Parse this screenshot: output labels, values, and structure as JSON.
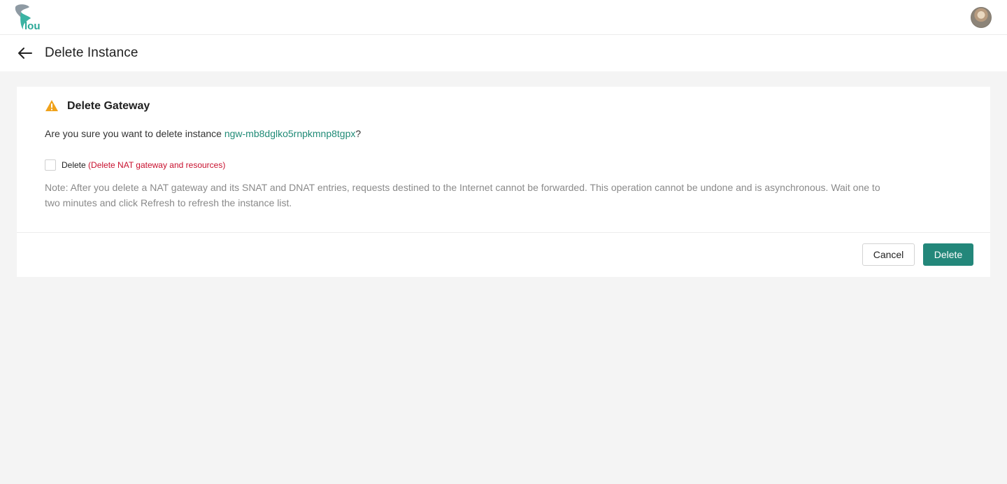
{
  "header": {
    "logo_icon": "flou-logo-icon",
    "avatar_icon": "user-avatar-icon"
  },
  "titlebar": {
    "back_icon": "arrow-left-icon",
    "title": "Delete Instance"
  },
  "card": {
    "warning_icon": "warning-triangle-icon",
    "heading": "Delete Gateway",
    "question_prefix": "Are you sure you want to delete instance ",
    "instance_id": "ngw-mb8dglko5rnpkmnp8tgpx",
    "question_suffix": "?",
    "checkbox": {
      "checked": false,
      "label": "Delete",
      "label_detail": "(Delete NAT gateway and resources)"
    },
    "note": "Note: After you delete a NAT gateway and its SNAT and DNAT entries, requests destined to the Internet cannot be forwarded. This operation cannot be undone and is asynchronous. Wait one to two minutes and click Refresh to refresh the instance list."
  },
  "actions": {
    "cancel_label": "Cancel",
    "delete_label": "Delete"
  },
  "colors": {
    "accent": "#23877a",
    "link": "#1f8a76",
    "danger": "#c8102e",
    "warning": "#f0a21b"
  }
}
